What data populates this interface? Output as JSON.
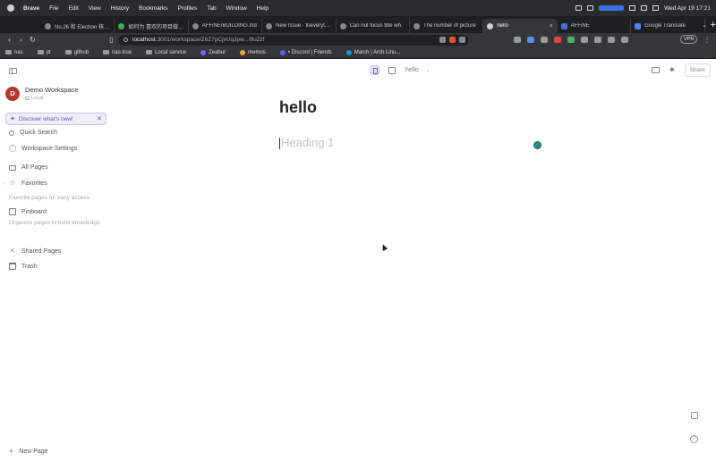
{
  "menubar": {
    "app": "Brave",
    "items": [
      "File",
      "Edit",
      "View",
      "History",
      "Bookmarks",
      "Profiles",
      "Tab",
      "Window",
      "Help"
    ],
    "datetime": "Wed Apr 19  17:21"
  },
  "tabs": [
    {
      "title": "No.26 和 Electron 核心...",
      "active": false
    },
    {
      "title": "如何为 喜欢的项目做贡献",
      "active": false
    },
    {
      "title": "AFFiNE/BUILDING.md",
      "active": false
    },
    {
      "title": "New Issue · toeverything",
      "active": false
    },
    {
      "title": "Can not focus title wh",
      "active": false
    },
    {
      "title": "The number of picture",
      "active": false
    },
    {
      "title": "hello",
      "active": true
    },
    {
      "title": "AFFiNE",
      "active": false
    },
    {
      "title": "Google Translate",
      "active": false
    }
  ],
  "address": {
    "host": "localhost",
    "path": ":3001/workspace/Z6Z7pCjvUqJpw.../8u2zf",
    "vpn": "VPN"
  },
  "bookmarks": [
    "nas",
    "pt",
    "github",
    "nas-true",
    "Local service",
    "Zeabur",
    "memos",
    "• Discord | Friends",
    "March | Arch Linu..."
  ],
  "sidebar": {
    "workspace_initial": "D",
    "workspace_name": "Demo Workspace",
    "workspace_type": "Local",
    "discover": "Discover what's new!",
    "quick_search": "Quick Search",
    "settings": "Workspace Settings",
    "all_pages": "All Pages",
    "favorites": "Favorites",
    "favorites_hint": "Favorite pages for easy access",
    "pinboard": "Pinboard",
    "pinboard_hint": "Organize pages to build knowledge",
    "shared_pages": "Shared Pages",
    "trash": "Trash",
    "new_page": "New Page"
  },
  "header": {
    "doc_title": "hello",
    "share": "Share"
  },
  "editor": {
    "title": "hello",
    "placeholder": "Heading 1"
  },
  "icons": [
    "sidebar-toggle-icon",
    "search-icon",
    "gear-icon",
    "folder-icon",
    "star-icon",
    "pin-icon",
    "share-icon",
    "trash-icon",
    "plus-icon",
    "sun-icon",
    "grid-icon",
    "help-icon"
  ]
}
